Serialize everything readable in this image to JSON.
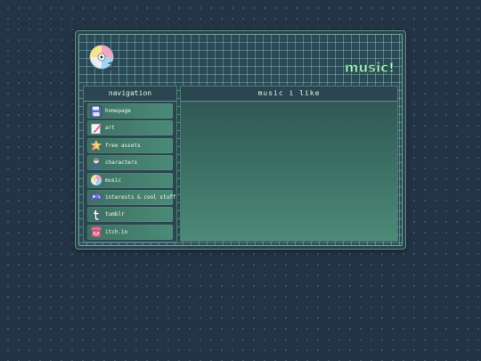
{
  "site": {
    "title": "music!"
  },
  "sidebar": {
    "title": "navigation",
    "items": [
      {
        "label": "homepage",
        "icon": "floppy-disk-icon"
      },
      {
        "label": "art",
        "icon": "paint-icon"
      },
      {
        "label": "free assets",
        "icon": "star-icon"
      },
      {
        "label": "characters",
        "icon": "user-icon"
      },
      {
        "label": "music",
        "icon": "cd-icon"
      },
      {
        "label": "interests & cool stuff",
        "icon": "gamepad-icon"
      },
      {
        "label": "tumblr",
        "icon": "tumblr-icon"
      },
      {
        "label": "itch.io",
        "icon": "itchio-icon"
      }
    ]
  },
  "main": {
    "title": "music i like"
  },
  "colors": {
    "background": "#223446",
    "accent": "#46806f",
    "title_fill": "#c9f3d9"
  }
}
